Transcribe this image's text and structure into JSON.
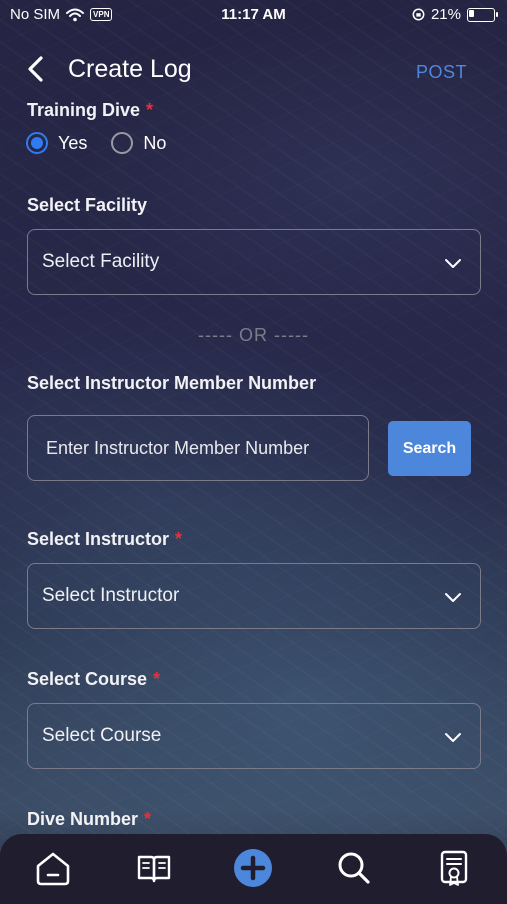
{
  "status_bar": {
    "carrier": "No SIM",
    "vpn": "VPN",
    "time": "11:17 AM",
    "battery": "21%",
    "battery_level": 0.21
  },
  "header": {
    "title": "Create Log",
    "post_label": "POST"
  },
  "form": {
    "training_dive": {
      "label": "Training Dive",
      "required_mark": "*",
      "options": [
        "Yes",
        "No"
      ],
      "selected": "Yes"
    },
    "facility": {
      "label": "Select Facility",
      "placeholder": "Select Facility"
    },
    "or_divider": "----- OR -----",
    "instructor_number": {
      "label": "Select Instructor Member Number",
      "placeholder": "Enter Instructor Member Number",
      "search_label": "Search"
    },
    "instructor": {
      "label": "Select Instructor",
      "required_mark": "*",
      "placeholder": "Select Instructor"
    },
    "course": {
      "label": "Select Course",
      "required_mark": "*",
      "placeholder": "Select Course"
    },
    "dive_number": {
      "label": "Dive Number",
      "required_mark": "*"
    }
  },
  "bottom_nav": {
    "items": [
      "home-icon",
      "book-icon",
      "add-icon",
      "search-icon",
      "certificate-icon"
    ],
    "accent": "#4d87dc"
  }
}
